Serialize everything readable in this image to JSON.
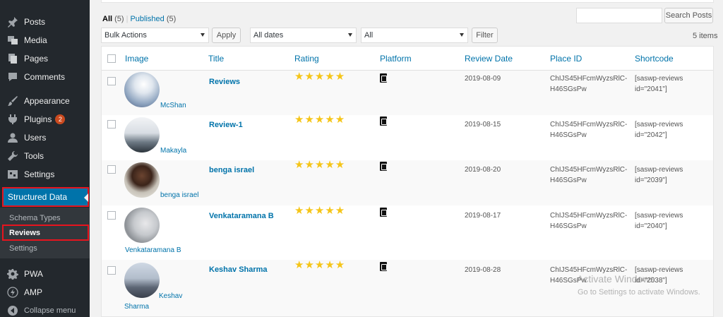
{
  "sidebar": {
    "items": [
      {
        "label": "Posts",
        "icon": "pushpin-icon"
      },
      {
        "label": "Media",
        "icon": "media-icon"
      },
      {
        "label": "Pages",
        "icon": "pages-icon"
      },
      {
        "label": "Comments",
        "icon": "comment-icon"
      },
      {
        "label": "Appearance",
        "icon": "paintbrush-icon"
      },
      {
        "label": "Plugins",
        "icon": "plugin-icon",
        "badge": "2"
      },
      {
        "label": "Users",
        "icon": "users-icon"
      },
      {
        "label": "Tools",
        "icon": "wrench-icon"
      },
      {
        "label": "Settings",
        "icon": "settings-icon"
      }
    ],
    "active": {
      "label": "Structured Data",
      "icon": "pushpin-icon"
    },
    "submenu": {
      "schema_types": "Schema Types",
      "reviews": "Reviews",
      "settings": "Settings"
    },
    "bottom": [
      {
        "label": "PWA",
        "icon": "gear-icon"
      },
      {
        "label": "AMP",
        "icon": "lightning-icon"
      },
      {
        "label": "Collapse menu",
        "icon": "collapse-icon"
      }
    ]
  },
  "filters": {
    "all_label": "All",
    "all_count": "(5)",
    "published_label": "Published",
    "published_count": "(5)",
    "search_button": "Search Posts",
    "bulk_actions": "Bulk Actions",
    "apply_button": "Apply",
    "dates": "All dates",
    "platforms": "All",
    "filter_button": "Filter",
    "items_count": "5 items"
  },
  "table": {
    "headers": {
      "image": "Image",
      "title": "Title",
      "rating": "Rating",
      "platform": "Platform",
      "review_date": "Review Date",
      "place_id": "Place ID",
      "shortcode": "Shortcode"
    },
    "rows": [
      {
        "author": "McShan",
        "title": "Reviews",
        "stars": "★★★★★",
        "date": "2019-08-09",
        "place_id_1": "ChIJS45HFcmWyzsRlC-",
        "place_id_2": "H46SGsPw",
        "shortcode_1": "[saswp-reviews",
        "shortcode_2": "id=\"2041\"]"
      },
      {
        "author": "Makayla",
        "title": "Review-1",
        "stars": "★★★★★",
        "date": "2019-08-15",
        "place_id_1": "ChIJS45HFcmWyzsRlC-",
        "place_id_2": "H46SGsPw",
        "shortcode_1": "[saswp-reviews",
        "shortcode_2": "id=\"2042\"]"
      },
      {
        "author": "benga israel",
        "title": "benga israel",
        "stars": "★★★★★",
        "date": "2019-08-20",
        "place_id_1": "ChIJS45HFcmWyzsRlC-",
        "place_id_2": "H46SGsPw",
        "shortcode_1": "[saswp-reviews",
        "shortcode_2": "id=\"2039\"]"
      },
      {
        "author": "Venkataramana B",
        "title": "Venkataramana B",
        "stars": "★★★★★",
        "date": "2019-08-17",
        "place_id_1": "ChIJS45HFcmWyzsRlC-",
        "place_id_2": "H46SGsPw",
        "shortcode_1": "[saswp-reviews",
        "shortcode_2": "id=\"2040\"]"
      },
      {
        "author_1": "Keshav",
        "author_2": "Sharma",
        "title": "Keshav Sharma",
        "stars": "★★★★★",
        "date": "2019-08-28",
        "place_id_1": "ChIJS45HFcmWyzsRlC-",
        "place_id_2": "H46SGsPw",
        "shortcode_1": "[saswp-reviews",
        "shortcode_2": "id=\"2038\"]"
      }
    ]
  },
  "watermark": {
    "line1": "Activate Windows",
    "line2": "Go to Settings to activate Windows."
  },
  "colors": {
    "accent": "#0073aa",
    "sidebar": "#23282d",
    "highlight": "#e8141e",
    "star": "#f5c518"
  }
}
